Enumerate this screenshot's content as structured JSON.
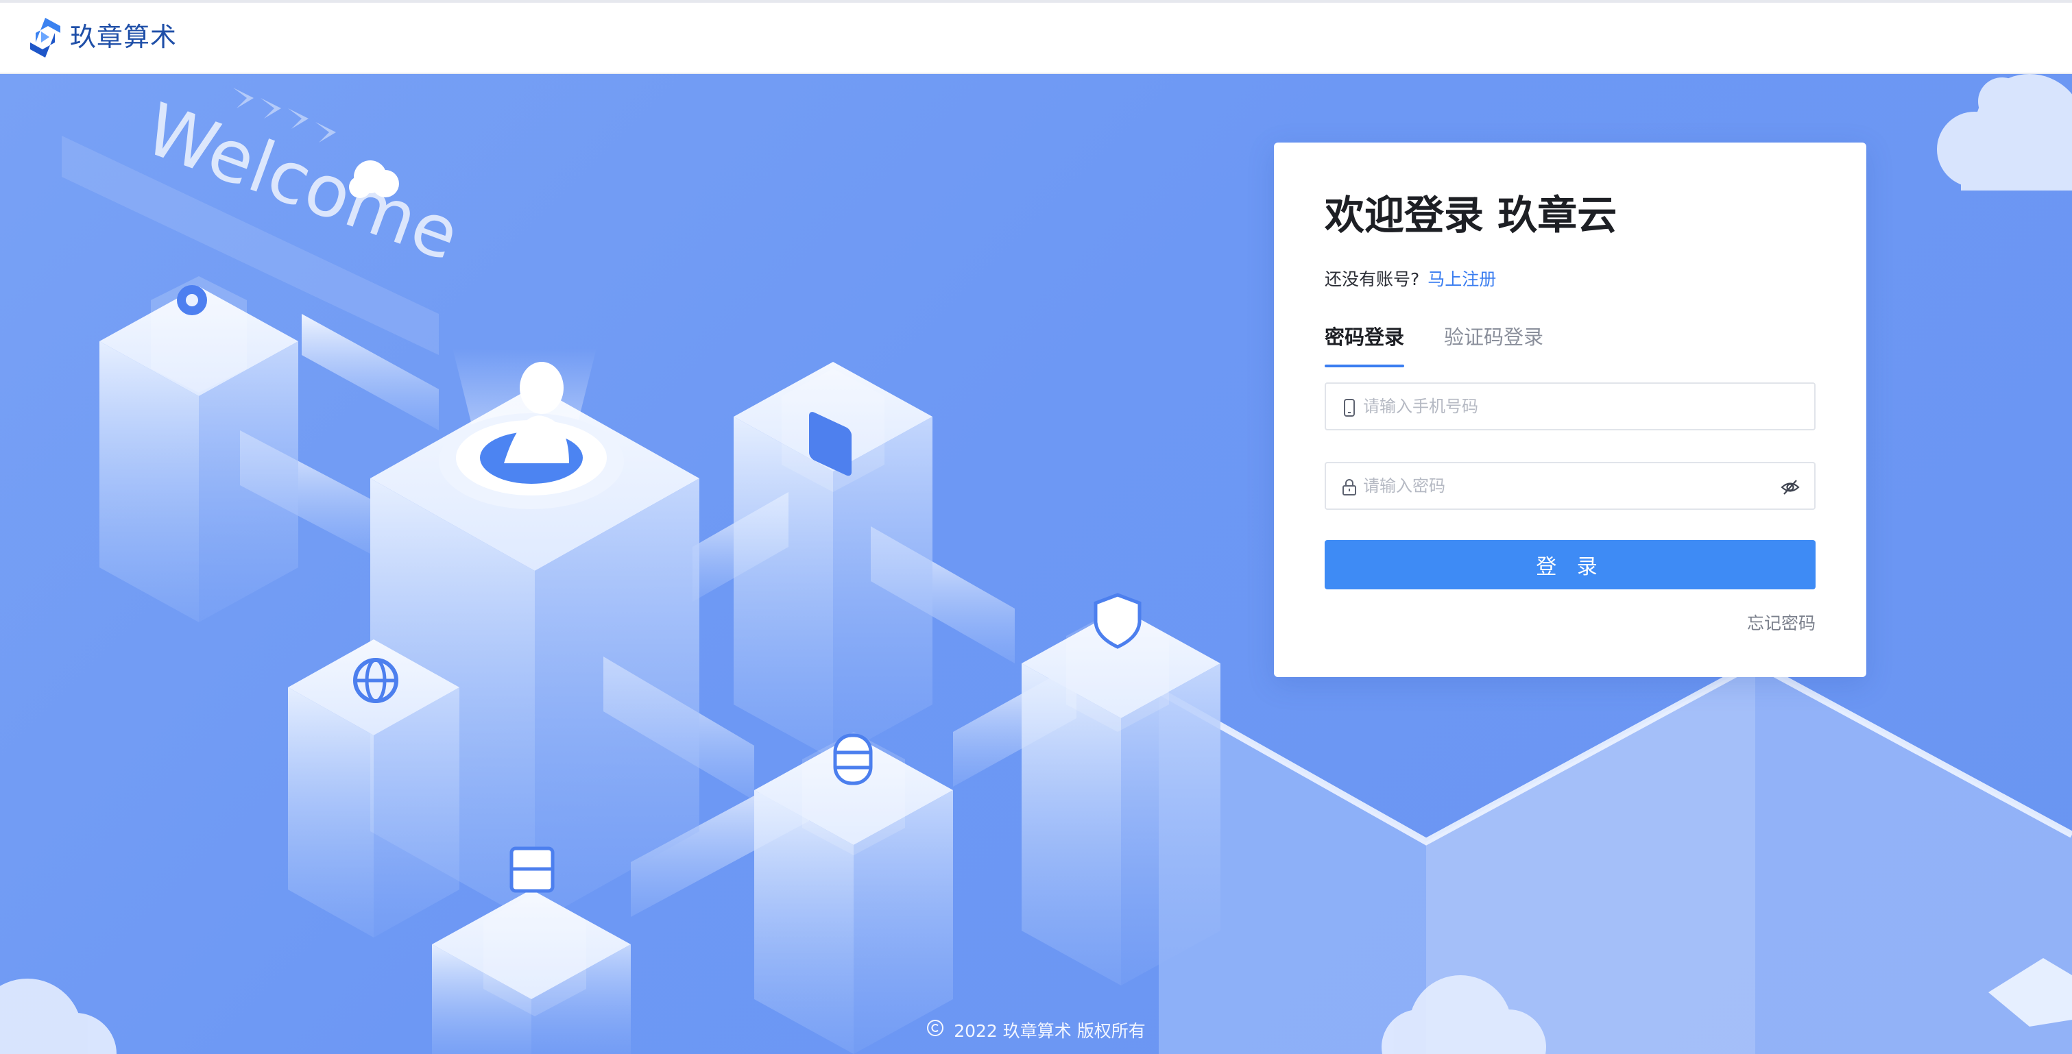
{
  "header": {
    "logo_icon": "jiuzhang-logo-icon",
    "brand_name": "玖章算术"
  },
  "hero": {
    "welcome_text": "Welcome",
    "illustration_icons": [
      "gear-icon",
      "user-icon",
      "tablet-icon",
      "globe-icon",
      "shield-icon",
      "database-icon",
      "archive-icon",
      "cloud-icon"
    ]
  },
  "login": {
    "title": "欢迎登录 玖章云",
    "register_prompt": "还没有账号?",
    "register_link": "马上注册",
    "tabs": [
      {
        "label": "密码登录",
        "active": true
      },
      {
        "label": "验证码登录",
        "active": false
      }
    ],
    "phone_placeholder": "请输入手机号码",
    "password_placeholder": "请输入密码",
    "submit_label": "登 录",
    "forgot_label": "忘记密码"
  },
  "footer": {
    "copyright": "2022 玖章算术 版权所有"
  },
  "colors": {
    "brand_blue": "#3e8bf5",
    "hero_background": "#6d98f4",
    "title_text": "#1d1f24",
    "link_blue": "#3a7df0"
  }
}
